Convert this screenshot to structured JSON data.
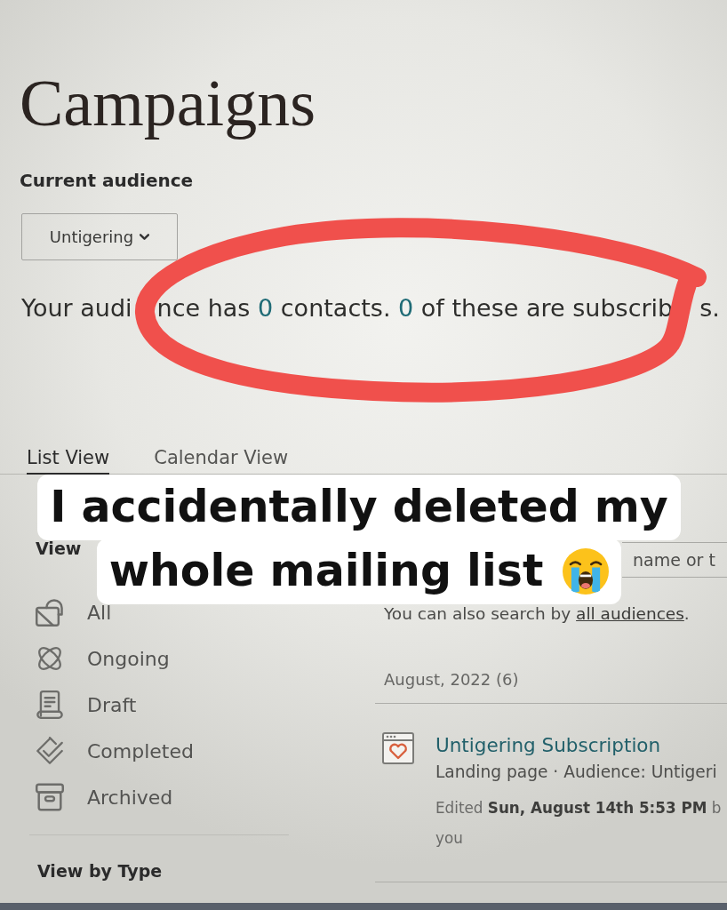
{
  "page": {
    "title": "Campaigns"
  },
  "audience": {
    "label": "Current audience",
    "dropdown": {
      "value": "Untigering"
    },
    "summary": [
      {
        "parts": [
          {
            "kind": "text",
            "text": "Your audi"
          }
        ]
      },
      {
        "parts": [
          {
            "kind": "text",
            "text": "nce has "
          },
          {
            "kind": "count",
            "text": "0"
          },
          {
            "kind": "text",
            "text": " contacts. "
          },
          {
            "kind": "count",
            "text": "0"
          },
          {
            "kind": "text",
            "text": " of these are subscrib"
          }
        ]
      },
      {
        "parts": [
          {
            "kind": "text",
            "text": "s."
          }
        ]
      }
    ]
  },
  "tabs": [
    {
      "label": "List View",
      "selected": true
    },
    {
      "label": "Calendar View",
      "selected": false
    }
  ],
  "caption": {
    "lines": [
      "I accidentally deleted my",
      "whole mailing list"
    ]
  },
  "sidebar": {
    "heading": "View",
    "items": [
      {
        "label": "All"
      },
      {
        "label": "Ongoing"
      },
      {
        "label": "Draft"
      },
      {
        "label": "Completed"
      },
      {
        "label": "Archived"
      }
    ],
    "section_heading": "View by Type"
  },
  "search": {
    "placeholder": "name or t",
    "hint": {
      "text": "You can also search by ",
      "link": "all audiences",
      "end": "."
    }
  },
  "campaigns": {
    "group": "August, 2022 (6)",
    "items": [
      {
        "title": "Untigering Subscription",
        "meta": "Landing page · Audience: Untigeri",
        "edited": [
          "Edited **Sun, August 14th 5:53 PM** b",
          "you"
        ]
      }
    ]
  }
}
